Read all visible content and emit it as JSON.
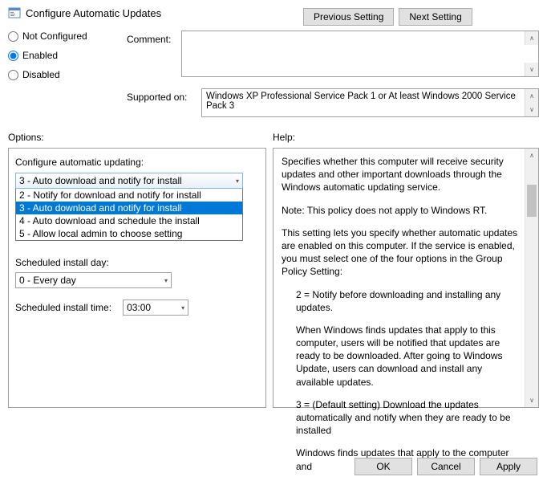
{
  "window": {
    "title": "Configure Automatic Updates"
  },
  "nav": {
    "prev": "Previous Setting",
    "next": "Next Setting"
  },
  "radios": {
    "not_configured": "Not Configured",
    "enabled": "Enabled",
    "disabled": "Disabled"
  },
  "fields": {
    "comment_label": "Comment:",
    "supported_label": "Supported on:",
    "supported_value": "Windows XP Professional Service Pack 1 or At least Windows 2000 Service Pack 3"
  },
  "sections": {
    "options": "Options:",
    "help": "Help:"
  },
  "options": {
    "configure_label": "Configure automatic updating:",
    "selected": "3 - Auto download and notify for install",
    "items": [
      "2 - Notify for download and notify for install",
      "3 - Auto download and notify for install",
      "4 - Auto download and schedule the install",
      "5 - Allow local admin to choose setting"
    ],
    "sched_day_label": "Scheduled install day:",
    "sched_day_value": "0 - Every day",
    "sched_time_label": "Scheduled install time:",
    "sched_time_value": "03:00"
  },
  "help": {
    "p1": "Specifies whether this computer will receive security updates and other important downloads through the Windows automatic updating service.",
    "p2": "Note: This policy does not apply to Windows RT.",
    "p3": "This setting lets you specify whether automatic updates are enabled on this computer. If the service is enabled, you must select one of the four options in the Group Policy Setting:",
    "p4": "2 = Notify before downloading and installing any updates.",
    "p5": "When Windows finds updates that apply to this computer, users will be notified that updates are ready to be downloaded. After going to Windows Update, users can download and install any available updates.",
    "p6": "3 = (Default setting) Download the updates automatically and notify when they are ready to be installed",
    "p7": "Windows finds updates that apply to the computer and"
  },
  "footer": {
    "ok": "OK",
    "cancel": "Cancel",
    "apply": "Apply"
  }
}
